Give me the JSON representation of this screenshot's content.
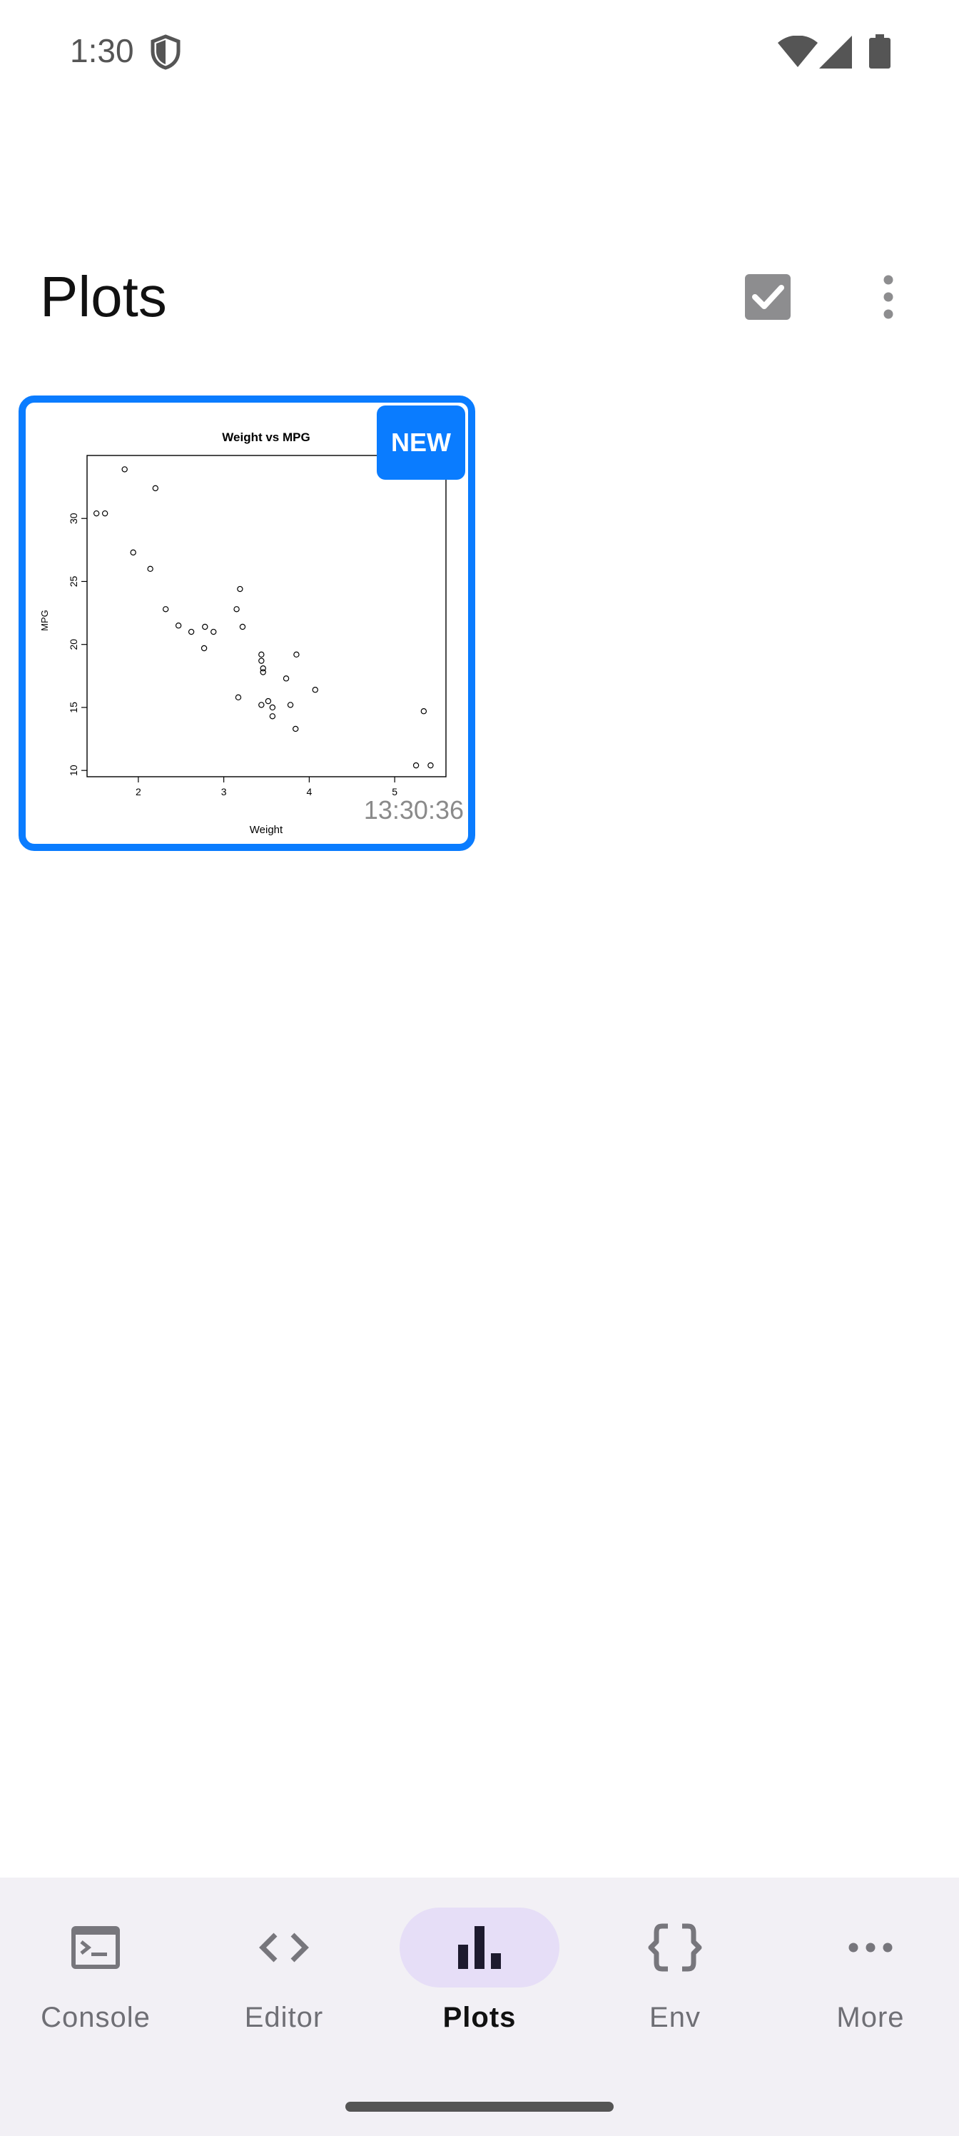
{
  "status_bar": {
    "time": "1:30",
    "icons": [
      "shield-icon",
      "wifi-icon",
      "signal-icon",
      "battery-icon"
    ]
  },
  "app_bar": {
    "title": "Plots",
    "actions": [
      "select-all-icon",
      "more-vert-icon"
    ]
  },
  "plots": [
    {
      "badge": "NEW",
      "timestamp": "13:30:36",
      "accent_color": "#0a7cff"
    }
  ],
  "chart_data": {
    "type": "scatter",
    "title": "Weight vs MPG",
    "xlabel": "Weight",
    "ylabel": "MPG",
    "xlim": [
      1.5,
      5.5
    ],
    "ylim": [
      10,
      35
    ],
    "x_ticks": [
      "2",
      "3",
      "4",
      "5"
    ],
    "y_ticks": [
      "10",
      "15",
      "20",
      "25",
      "30"
    ],
    "series": [
      {
        "x": [
          1.51,
          1.61,
          1.84,
          1.94,
          2.14,
          2.2,
          2.32,
          2.47,
          2.62,
          2.77,
          2.78,
          2.88,
          3.15,
          3.17,
          3.19,
          3.22,
          3.44,
          3.44,
          3.44,
          3.46,
          3.46,
          3.52,
          3.57,
          3.57,
          3.73,
          3.78,
          3.84,
          3.85,
          4.07,
          5.25,
          5.34,
          5.42
        ],
        "y": [
          30.4,
          30.4,
          33.9,
          27.3,
          26.0,
          32.4,
          22.8,
          21.5,
          21.0,
          19.7,
          21.4,
          21.0,
          22.8,
          15.8,
          24.4,
          21.4,
          15.2,
          19.2,
          18.7,
          17.8,
          18.1,
          15.5,
          14.3,
          15.0,
          17.3,
          15.2,
          13.3,
          19.2,
          16.4,
          10.4,
          14.7,
          10.4
        ]
      }
    ]
  },
  "bottom_nav": {
    "items": [
      {
        "label": "Console",
        "icon": "terminal-icon",
        "active": false
      },
      {
        "label": "Editor",
        "icon": "code-icon",
        "active": false
      },
      {
        "label": "Plots",
        "icon": "bar-chart-icon",
        "active": true
      },
      {
        "label": "Env",
        "icon": "braces-icon",
        "active": false
      },
      {
        "label": "More",
        "icon": "more-horiz-icon",
        "active": false
      }
    ]
  }
}
